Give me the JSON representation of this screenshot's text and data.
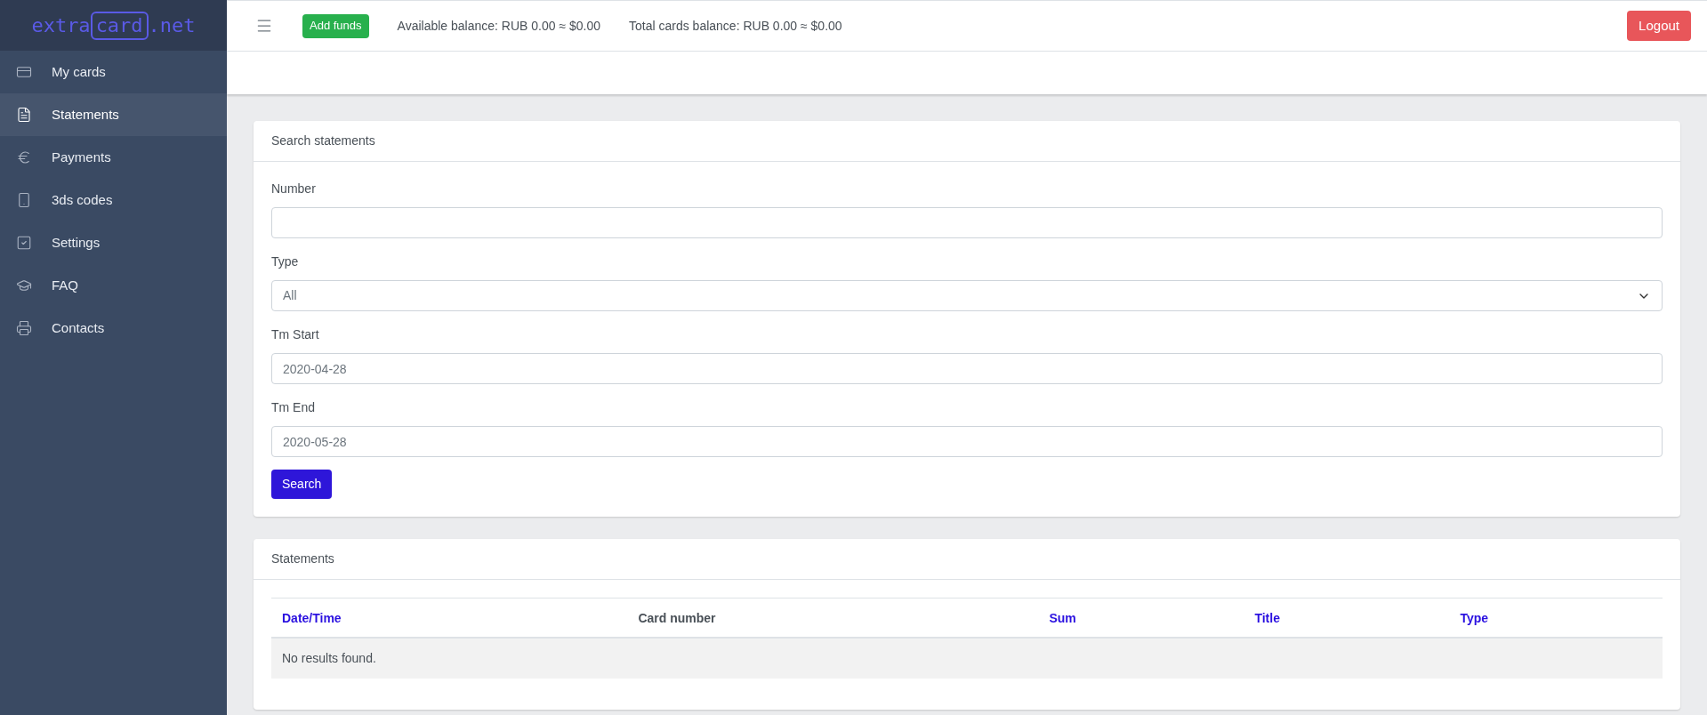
{
  "logo": {
    "left": "extra",
    "boxed": "card",
    "right": ".net"
  },
  "sidebar": {
    "items": [
      {
        "label": "My cards",
        "selected": false
      },
      {
        "label": "Statements",
        "selected": true
      },
      {
        "label": "Payments",
        "selected": false
      },
      {
        "label": "3ds codes",
        "selected": false
      },
      {
        "label": "Settings",
        "selected": false
      },
      {
        "label": "FAQ",
        "selected": false
      },
      {
        "label": "Contacts",
        "selected": false
      }
    ]
  },
  "topbar": {
    "add_funds": "Add funds",
    "available_balance": "Available balance: RUB 0.00 ≈ $0.00",
    "total_balance": "Total cards balance: RUB 0.00 ≈ $0.00",
    "logout": "Logout"
  },
  "search_card": {
    "title": "Search statements",
    "fields": [
      {
        "label": "Number",
        "kind": "input"
      },
      {
        "label": "Type",
        "kind": "select",
        "value": "All"
      },
      {
        "label": "Tm Start",
        "kind": "input",
        "value": "2020-04-28"
      },
      {
        "label": "Tm End",
        "kind": "input",
        "value": "2020-05-28"
      }
    ],
    "button": "Search"
  },
  "statements_card": {
    "title": "Statements",
    "columns": [
      {
        "label": "Date/Time",
        "kind": "link"
      },
      {
        "label": "Card number",
        "kind": "plain"
      },
      {
        "label": "Sum",
        "kind": "link"
      },
      {
        "label": "Title",
        "kind": "link"
      },
      {
        "label": "Type",
        "kind": "link"
      }
    ],
    "empty": "No results found."
  }
}
